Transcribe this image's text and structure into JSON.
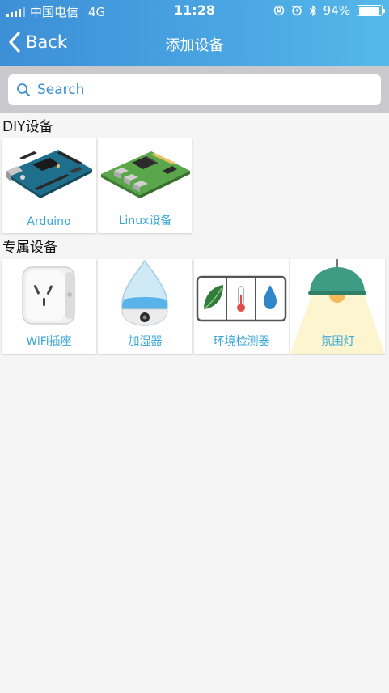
{
  "status_bar": {
    "carrier": "中国电信",
    "network": "4G",
    "time": "11:28",
    "battery": "94%",
    "battery_level": 0.94
  },
  "nav": {
    "back_label": "Back",
    "title": "添加设备"
  },
  "search": {
    "placeholder": "Search"
  },
  "sections": [
    {
      "title": "DIY设备",
      "items": [
        {
          "label": "Arduino",
          "icon": "arduino-board-icon"
        },
        {
          "label": "Linux设备",
          "icon": "linux-board-icon"
        }
      ]
    },
    {
      "title": "专属设备",
      "items": [
        {
          "label": "WiFi插座",
          "icon": "wifi-socket-icon"
        },
        {
          "label": "加湿器",
          "icon": "humidifier-icon"
        },
        {
          "label": "环境检测器",
          "icon": "environment-sensor-icon"
        },
        {
          "label": "氛围灯",
          "icon": "ambient-lamp-icon"
        }
      ]
    }
  ],
  "colors": {
    "header_start": "#3d8fd6",
    "header_end": "#55b8ea",
    "label": "#3aa7d8",
    "search_text": "#3a8fd0"
  }
}
